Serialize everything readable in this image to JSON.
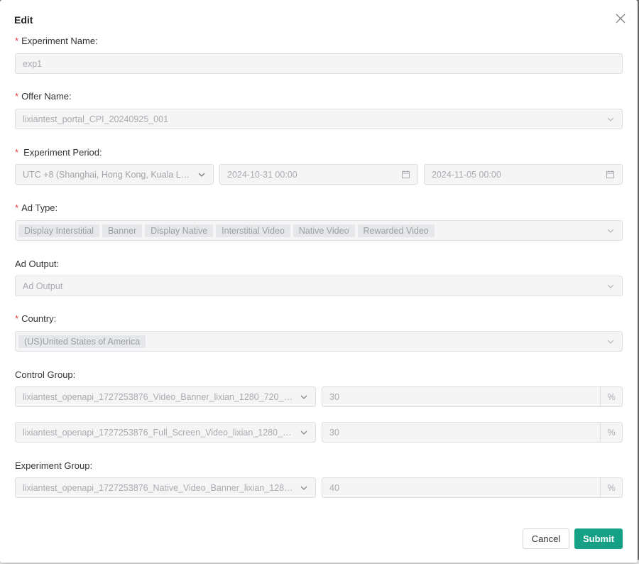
{
  "dialog": {
    "title": "Edit",
    "cancel_label": "Cancel",
    "submit_label": "Submit"
  },
  "fields": {
    "experiment_name": {
      "label": "Experiment Name:",
      "placeholder": "exp1"
    },
    "offer_name": {
      "label": "Offer Name:",
      "value": "lixiantest_portal_CPI_20240925_001"
    },
    "experiment_period": {
      "label": "Experiment Period:",
      "timezone": "UTC +8 (Shanghai, Hong Kong, Kuala Lum...",
      "start": "2024-10-31 00:00",
      "end": "2024-11-05 00:00"
    },
    "ad_type": {
      "label": "Ad Type:",
      "tags": [
        "Display Interstitial",
        "Banner",
        "Display Native",
        "Interstitial Video",
        "Native Video",
        "Rewarded Video"
      ]
    },
    "ad_output": {
      "label": "Ad Output:",
      "placeholder": "Ad Output"
    },
    "country": {
      "label": "Country:",
      "tags": [
        "(US)United States of America"
      ]
    },
    "control_group": {
      "label": "Control Group:",
      "rows": [
        {
          "creative": "lixiantest_openapi_1727253876_Video_Banner_lixian_1280_720_30fp...",
          "percent": "30",
          "unit": "%"
        },
        {
          "creative": "lixiantest_openapi_1727253876_Full_Screen_Video_lixian_1280_720_...",
          "percent": "30",
          "unit": "%"
        }
      ]
    },
    "experiment_group": {
      "label": "Experiment Group:",
      "rows": [
        {
          "creative": "lixiantest_openapi_1727253876_Native_Video_Banner_lixian_1280_7...",
          "percent": "40",
          "unit": "%"
        }
      ]
    }
  },
  "icons": {
    "close": "close-icon",
    "chevron": "chevron-down-icon",
    "calendar": "calendar-icon"
  },
  "colors": {
    "primary": "#16a085",
    "required": "#e23a3a"
  }
}
